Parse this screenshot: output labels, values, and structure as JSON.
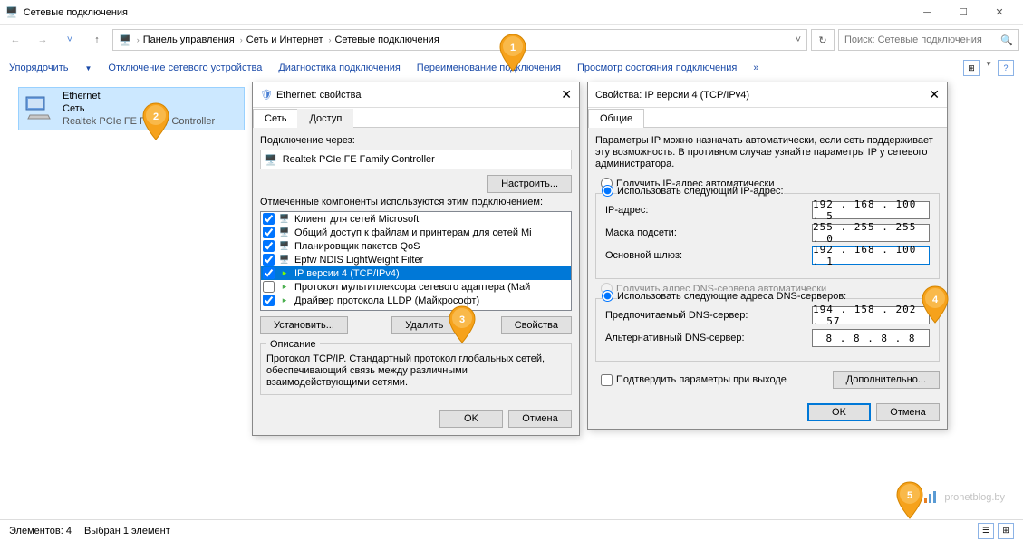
{
  "window": {
    "title": "Сетевые подключения",
    "search_placeholder": "Поиск: Сетевые подключения"
  },
  "breadcrumb": [
    "Панель управления",
    "Сеть и Интернет",
    "Сетевые подключения"
  ],
  "toolbar": {
    "organize": "Упорядочить",
    "items": [
      "Отключение сетевого устройства",
      "Диагностика подключения",
      "Переименование подключения",
      "Просмотр состояния подключения"
    ]
  },
  "net_item": {
    "name": "Ethernet",
    "sub1": "Сеть",
    "sub2": "Realtek PCIe FE Family Controller"
  },
  "dlg1": {
    "title": "Ethernet: свойства",
    "tab_net": "Сеть",
    "tab_access": "Доступ",
    "connect_via": "Подключение через:",
    "adapter": "Realtek PCIe FE Family Controller",
    "configure": "Настроить...",
    "components_label": "Отмеченные компоненты используются этим подключением:",
    "components": [
      {
        "checked": true,
        "label": "Клиент для сетей Microsoft"
      },
      {
        "checked": true,
        "label": "Общий доступ к файлам и принтерам для сетей Mi"
      },
      {
        "checked": true,
        "label": "Планировщик пакетов QoS"
      },
      {
        "checked": true,
        "label": "Epfw NDIS LightWeight Filter"
      },
      {
        "checked": true,
        "label": "IP версии 4 (TCP/IPv4)",
        "selected": true
      },
      {
        "checked": false,
        "label": "Протокол мультиплексора сетевого адаптера (Май"
      },
      {
        "checked": true,
        "label": "Драйвер протокола LLDP (Майкрософт)"
      }
    ],
    "install": "Установить...",
    "uninstall": "Удалить",
    "properties": "Свойства",
    "desc_title": "Описание",
    "desc_text": "Протокол TCP/IP. Стандартный протокол глобальных сетей, обеспечивающий связь между различными взаимодействующими сетями.",
    "ok": "OK",
    "cancel": "Отмена"
  },
  "dlg2": {
    "title": "Свойства: IP версии 4 (TCP/IPv4)",
    "tab_general": "Общие",
    "help_text": "Параметры IP можно назначать автоматически, если сеть поддерживает эту возможность. В противном случае узнайте параметры IP у сетевого администратора.",
    "auto_ip": "Получить IP-адрес автоматически",
    "use_ip": "Использовать следующий IP-адрес:",
    "ip_label": "IP-адрес:",
    "ip_value": "192 . 168 . 100 .   5",
    "mask_label": "Маска подсети:",
    "mask_value": "255 . 255 . 255 .   0",
    "gateway_label": "Основной шлюз:",
    "gateway_value": "192 . 168 . 100 .   1",
    "auto_dns": "Получить адрес DNS-сервера автоматически",
    "use_dns": "Использовать следующие адреса DNS-серверов:",
    "dns1_label": "Предпочитаемый DNS-сервер:",
    "dns1_value": "194 . 158 . 202 .  57",
    "dns2_label": "Альтернативный DNS-сервер:",
    "dns2_value": "  8 .   8 .   8 .   8",
    "confirm_on_exit": "Подтвердить параметры при выходе",
    "advanced": "Дополнительно...",
    "ok": "OK",
    "cancel": "Отмена"
  },
  "status": {
    "count": "Элементов: 4",
    "selected": "Выбран 1 элемент"
  },
  "watermark": "pronetblog.by"
}
